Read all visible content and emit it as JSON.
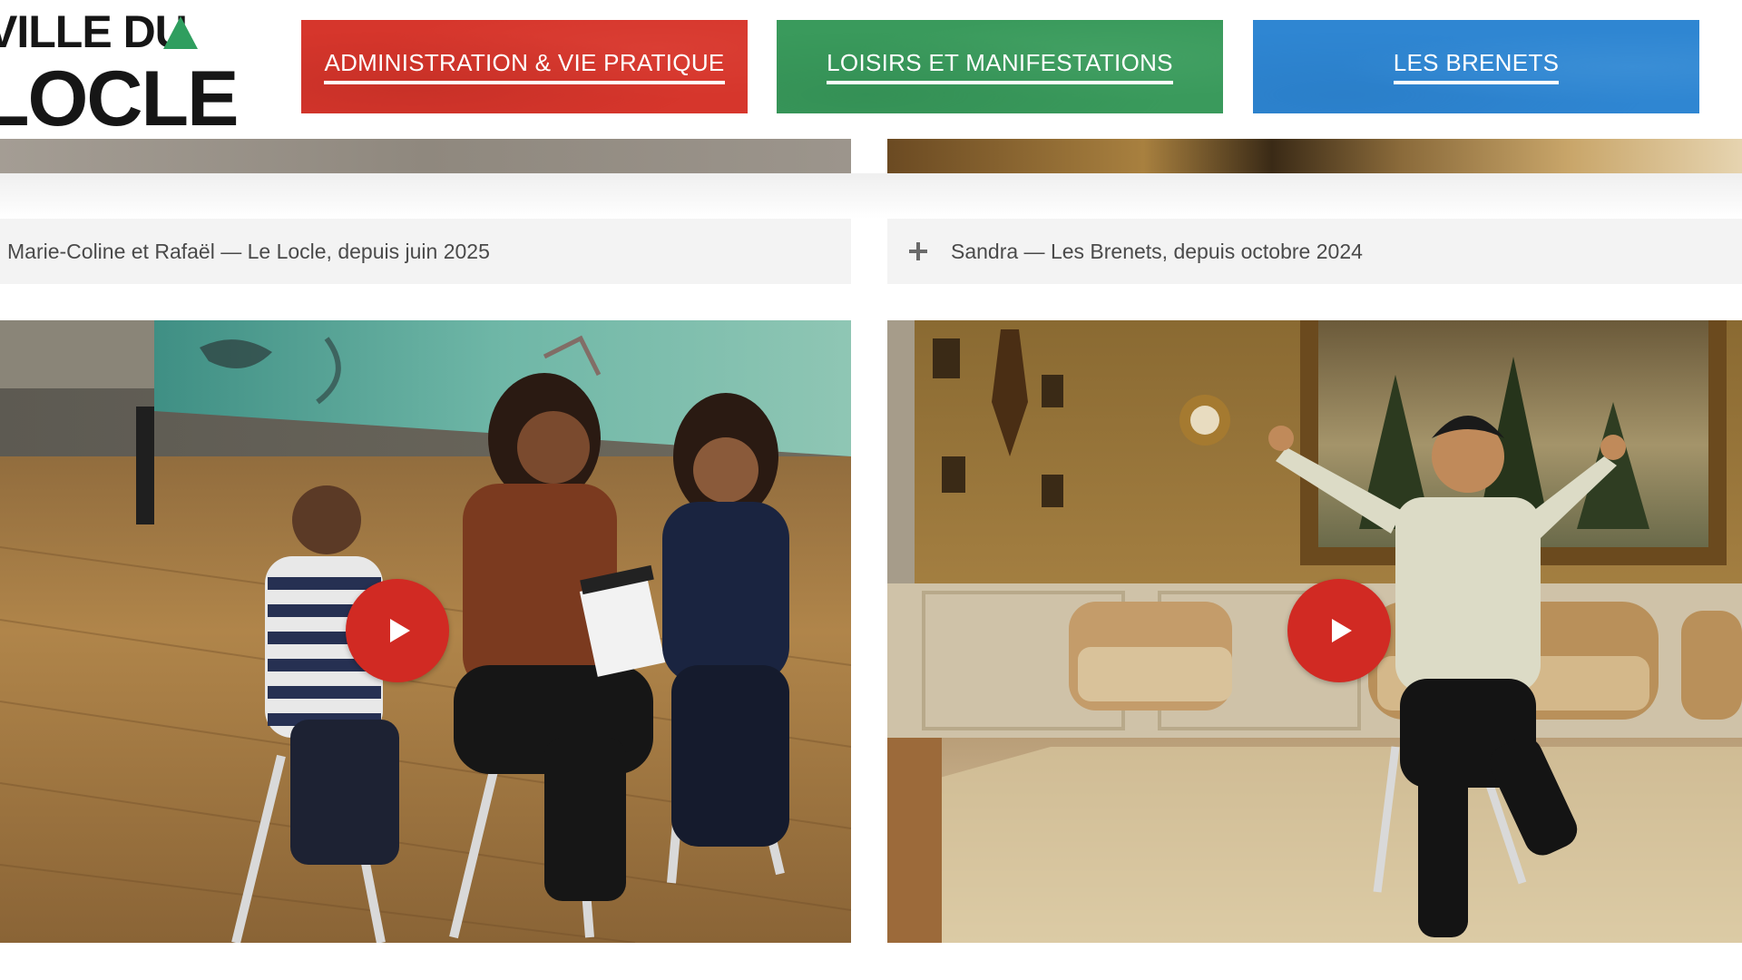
{
  "logo": {
    "line1": "VILLE DU",
    "line2": "LOCLE",
    "accent_color": "#2f9e5f"
  },
  "nav": {
    "items": [
      {
        "label": "ADMINISTRATION & VIE PRATIQUE",
        "color": "#d6362c"
      },
      {
        "label": "LOISIRS ET MANIFESTATIONS",
        "color": "#3a9a5c"
      },
      {
        "label": "LES BRENETS",
        "color": "#2f86d2"
      }
    ]
  },
  "testimonials": [
    {
      "title": "Marie-Coline et Rafaël — Le Locle, depuis juin 2025",
      "expand_icon": "plus-icon",
      "video": {
        "play_icon": "play-icon",
        "play_color": "#d12a23"
      }
    },
    {
      "title": "Sandra — Les Brenets, depuis octobre 2024",
      "expand_icon": "plus-icon",
      "video": {
        "play_icon": "play-icon",
        "play_color": "#d12a23"
      }
    }
  ]
}
